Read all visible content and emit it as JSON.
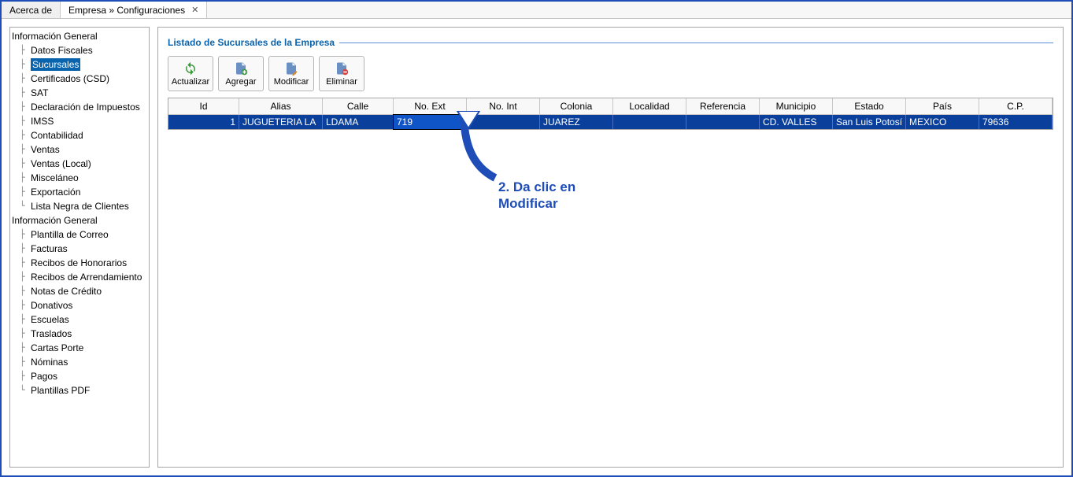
{
  "tabs": [
    {
      "label": "Acerca de",
      "active": false,
      "closable": false
    },
    {
      "label": "Empresa » Configuraciones",
      "active": true,
      "closable": true
    }
  ],
  "sidebar": {
    "groups": [
      {
        "header": "Información General",
        "items": [
          {
            "label": "Datos Fiscales"
          },
          {
            "label": "Sucursales",
            "selected": true
          },
          {
            "label": "Certificados (CSD)"
          },
          {
            "label": "SAT"
          },
          {
            "label": "Declaración de Impuestos"
          },
          {
            "label": "IMSS"
          },
          {
            "label": "Contabilidad"
          },
          {
            "label": "Ventas"
          },
          {
            "label": "Ventas (Local)"
          },
          {
            "label": "Misceláneo"
          },
          {
            "label": "Exportación"
          },
          {
            "label": "Lista Negra de Clientes"
          }
        ]
      },
      {
        "header": "Información General",
        "items": [
          {
            "label": "Plantilla de Correo"
          },
          {
            "label": "Facturas"
          },
          {
            "label": "Recibos de Honorarios"
          },
          {
            "label": "Recibos de Arrendamiento"
          },
          {
            "label": "Notas de Crédito"
          },
          {
            "label": "Donativos"
          },
          {
            "label": "Escuelas"
          },
          {
            "label": "Traslados"
          },
          {
            "label": "Cartas Porte"
          },
          {
            "label": "Nóminas"
          },
          {
            "label": "Pagos"
          },
          {
            "label": "Plantillas PDF"
          }
        ]
      }
    ]
  },
  "content": {
    "section_title": "Listado de Sucursales de la Empresa",
    "buttons": {
      "refresh": "Actualizar",
      "add": "Agregar",
      "edit": "Modificar",
      "delete": "Eliminar"
    },
    "grid": {
      "columns": [
        "Id",
        "Alias",
        "Calle",
        "No. Ext",
        "No. Int",
        "Colonia",
        "Localidad",
        "Referencia",
        "Municipio",
        "Estado",
        "País",
        "C.P."
      ],
      "rows": [
        {
          "id": "1",
          "alias": "JUGUETERIA LA",
          "calle": "LDAMA",
          "ext": "719",
          "int": "",
          "colonia": "JUAREZ",
          "localidad": "",
          "referencia": "",
          "municipio": "CD. VALLES",
          "estado": "San Luis Potosí",
          "pais": "MEXICO",
          "cp": "79636"
        }
      ]
    }
  },
  "annotation": {
    "text_line1": "2. Da clic en",
    "text_line2": "Modificar"
  }
}
